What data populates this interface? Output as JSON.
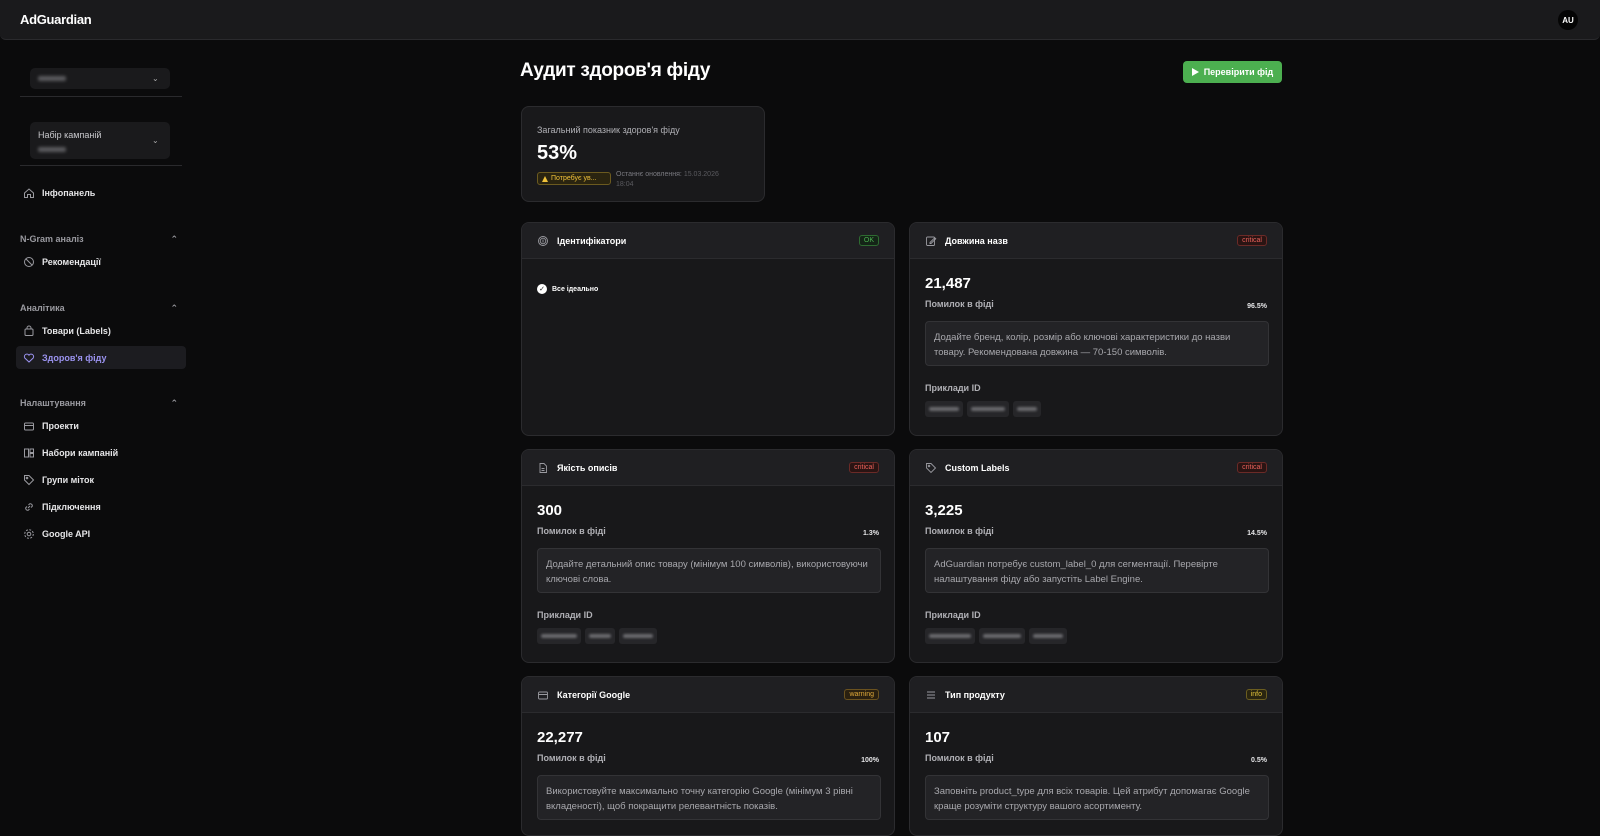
{
  "app": {
    "name": "AdGuardian",
    "user_initials": "AU"
  },
  "sidebar": {
    "campaign_set_label": "Набір кампаній",
    "items_top": [
      {
        "label": "Інфопанель",
        "icon": "home-icon"
      }
    ],
    "sections": [
      {
        "title": "N-Gram аналіз",
        "items": [
          {
            "label": "Рекомендації",
            "icon": "ban-icon"
          }
        ]
      },
      {
        "title": "Аналітика",
        "items": [
          {
            "label": "Товари (Labels)",
            "icon": "bag-icon"
          },
          {
            "label": "Здоров'я фіду",
            "icon": "heart-icon",
            "active": true
          }
        ]
      },
      {
        "title": "Налаштування",
        "items": [
          {
            "label": "Проекти",
            "icon": "box-icon"
          },
          {
            "label": "Набори кампаній",
            "icon": "grid-icon"
          },
          {
            "label": "Групи міток",
            "icon": "tag-icon"
          },
          {
            "label": "Підключення",
            "icon": "link-icon"
          },
          {
            "label": "Google API",
            "icon": "gear-icon"
          }
        ]
      }
    ]
  },
  "page": {
    "title": "Аудит здоров'я фіду",
    "check_button": "Перевірити фід"
  },
  "score": {
    "label": "Загальний показник здоров'я фіду",
    "value": "53%",
    "badge": "Потребує ув...",
    "updated_label": "Останнє оновлення:",
    "updated_value": "15.03.2026",
    "updated_time": "18:04"
  },
  "cards": [
    {
      "title": "Ідентифікатори",
      "icon": "fingerprint-icon",
      "tag": "OK",
      "tag_type": "ok",
      "ok_text": "Все ідеально"
    },
    {
      "title": "Довжина назв",
      "icon": "edit-icon",
      "tag": "critical",
      "tag_type": "critical",
      "count": "21,487",
      "errors_label": "Помилок в фіді",
      "percent": "96.5%",
      "description": "Додайте бренд, колір, розмір або ключові характеристики до назви товару. Рекомендована довжина — 70-150 символів.",
      "examples_label": "Приклади ID"
    },
    {
      "title": "Якість описів",
      "icon": "doc-icon",
      "tag": "critical",
      "tag_type": "critical",
      "count": "300",
      "errors_label": "Помилок в фіді",
      "percent": "1.3%",
      "description": "Додайте детальний опис товару (мінімум 100 символів), використовуючи ключові слова.",
      "examples_label": "Приклади ID"
    },
    {
      "title": "Custom Labels",
      "icon": "tag-icon",
      "tag": "critical",
      "tag_type": "critical",
      "count": "3,225",
      "errors_label": "Помилок в фіді",
      "percent": "14.5%",
      "description": "AdGuardian потребує custom_label_0 для сегментації. Перевірте налаштування фіду або запустіть Label Engine.",
      "examples_label": "Приклади ID"
    },
    {
      "title": "Категорії Google",
      "icon": "box-icon",
      "tag": "warning",
      "tag_type": "warning",
      "count": "22,277",
      "errors_label": "Помилок в фіді",
      "percent": "100%",
      "description": "Використовуйте максимально точну категорію Google (мінімум 3 рівні вкладеності), щоб покращити релевантність показів."
    },
    {
      "title": "Тип продукту",
      "icon": "list-icon",
      "tag": "info",
      "tag_type": "info",
      "count": "107",
      "errors_label": "Помилок в фіді",
      "percent": "0.5%",
      "description": "Заповніть product_type для всіх товарів. Цей атрибут допомагає Google краще розуміти структуру вашого асортименту."
    }
  ]
}
